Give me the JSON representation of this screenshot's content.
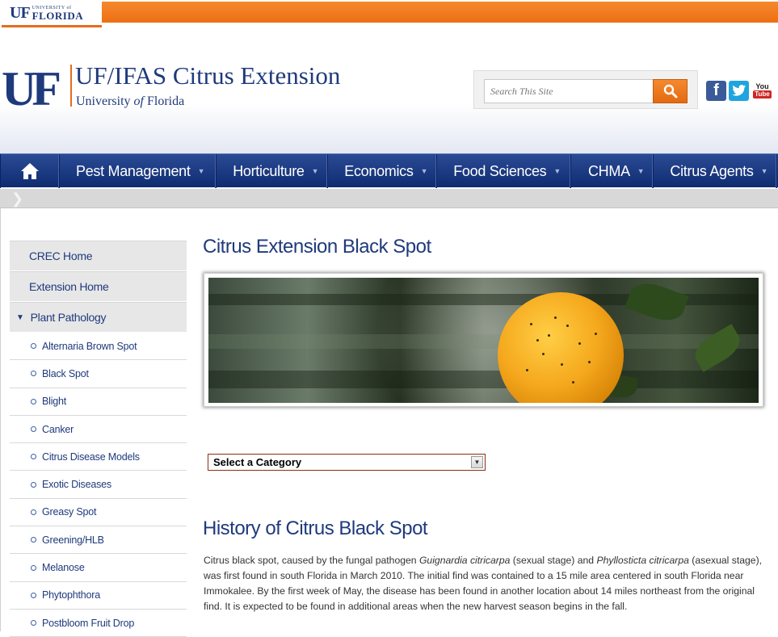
{
  "topbar": {
    "badge_uf": "UF",
    "badge_small": "UNIVERSITY of",
    "badge_big": "FLORIDA"
  },
  "header": {
    "logo": "UF",
    "title": "UF/IFAS Citrus Extension",
    "subtitle_pre": "University ",
    "subtitle_of": "of",
    "subtitle_post": " Florida",
    "search_placeholder": "Search This Site",
    "social": {
      "facebook": "f",
      "youtube_you": "You",
      "youtube_tube": "Tube"
    }
  },
  "nav": {
    "items": [
      {
        "label": "Pest Management"
      },
      {
        "label": "Horticulture"
      },
      {
        "label": "Economics"
      },
      {
        "label": "Food Sciences"
      },
      {
        "label": "CHMA"
      },
      {
        "label": "Citrus Agents"
      }
    ],
    "caret": "▼"
  },
  "sidebar": {
    "top_items": [
      "CREC Home",
      "Extension Home"
    ],
    "section": "Plant Pathology",
    "sub_items": [
      "Alternaria Brown Spot",
      "Black Spot",
      "Blight",
      "Canker",
      "Citrus Disease Models",
      "Exotic Diseases",
      "Greasy Spot",
      "Greening/HLB",
      "Melanose",
      "Phytophthora",
      "Postbloom Fruit Drop"
    ]
  },
  "main": {
    "page_title": "Citrus Extension Black Spot",
    "category_select": "Select a Category",
    "history_title": "History of Citrus Black Spot",
    "history": {
      "p1": "Citrus black spot, caused by the fungal pathogen ",
      "pathogen1": "Guignardia citricarpa",
      "p2": " (sexual stage) and ",
      "pathogen2": "Phyllosticta citricarpa",
      "p3": " (asexual stage), was first found in south Florida in March 2010. The initial find was contained to a 15 mile area centered in south Florida near Immokalee. By the first week of May, the disease has been found in another location about 14 miles northeast from the original find. It is expected to be found in additional areas when the new harvest season begins in the fall."
    }
  },
  "colors": {
    "brand_blue": "#1f3a7c",
    "brand_orange": "#e46d1d",
    "nav_blue": "#1c3a82"
  }
}
